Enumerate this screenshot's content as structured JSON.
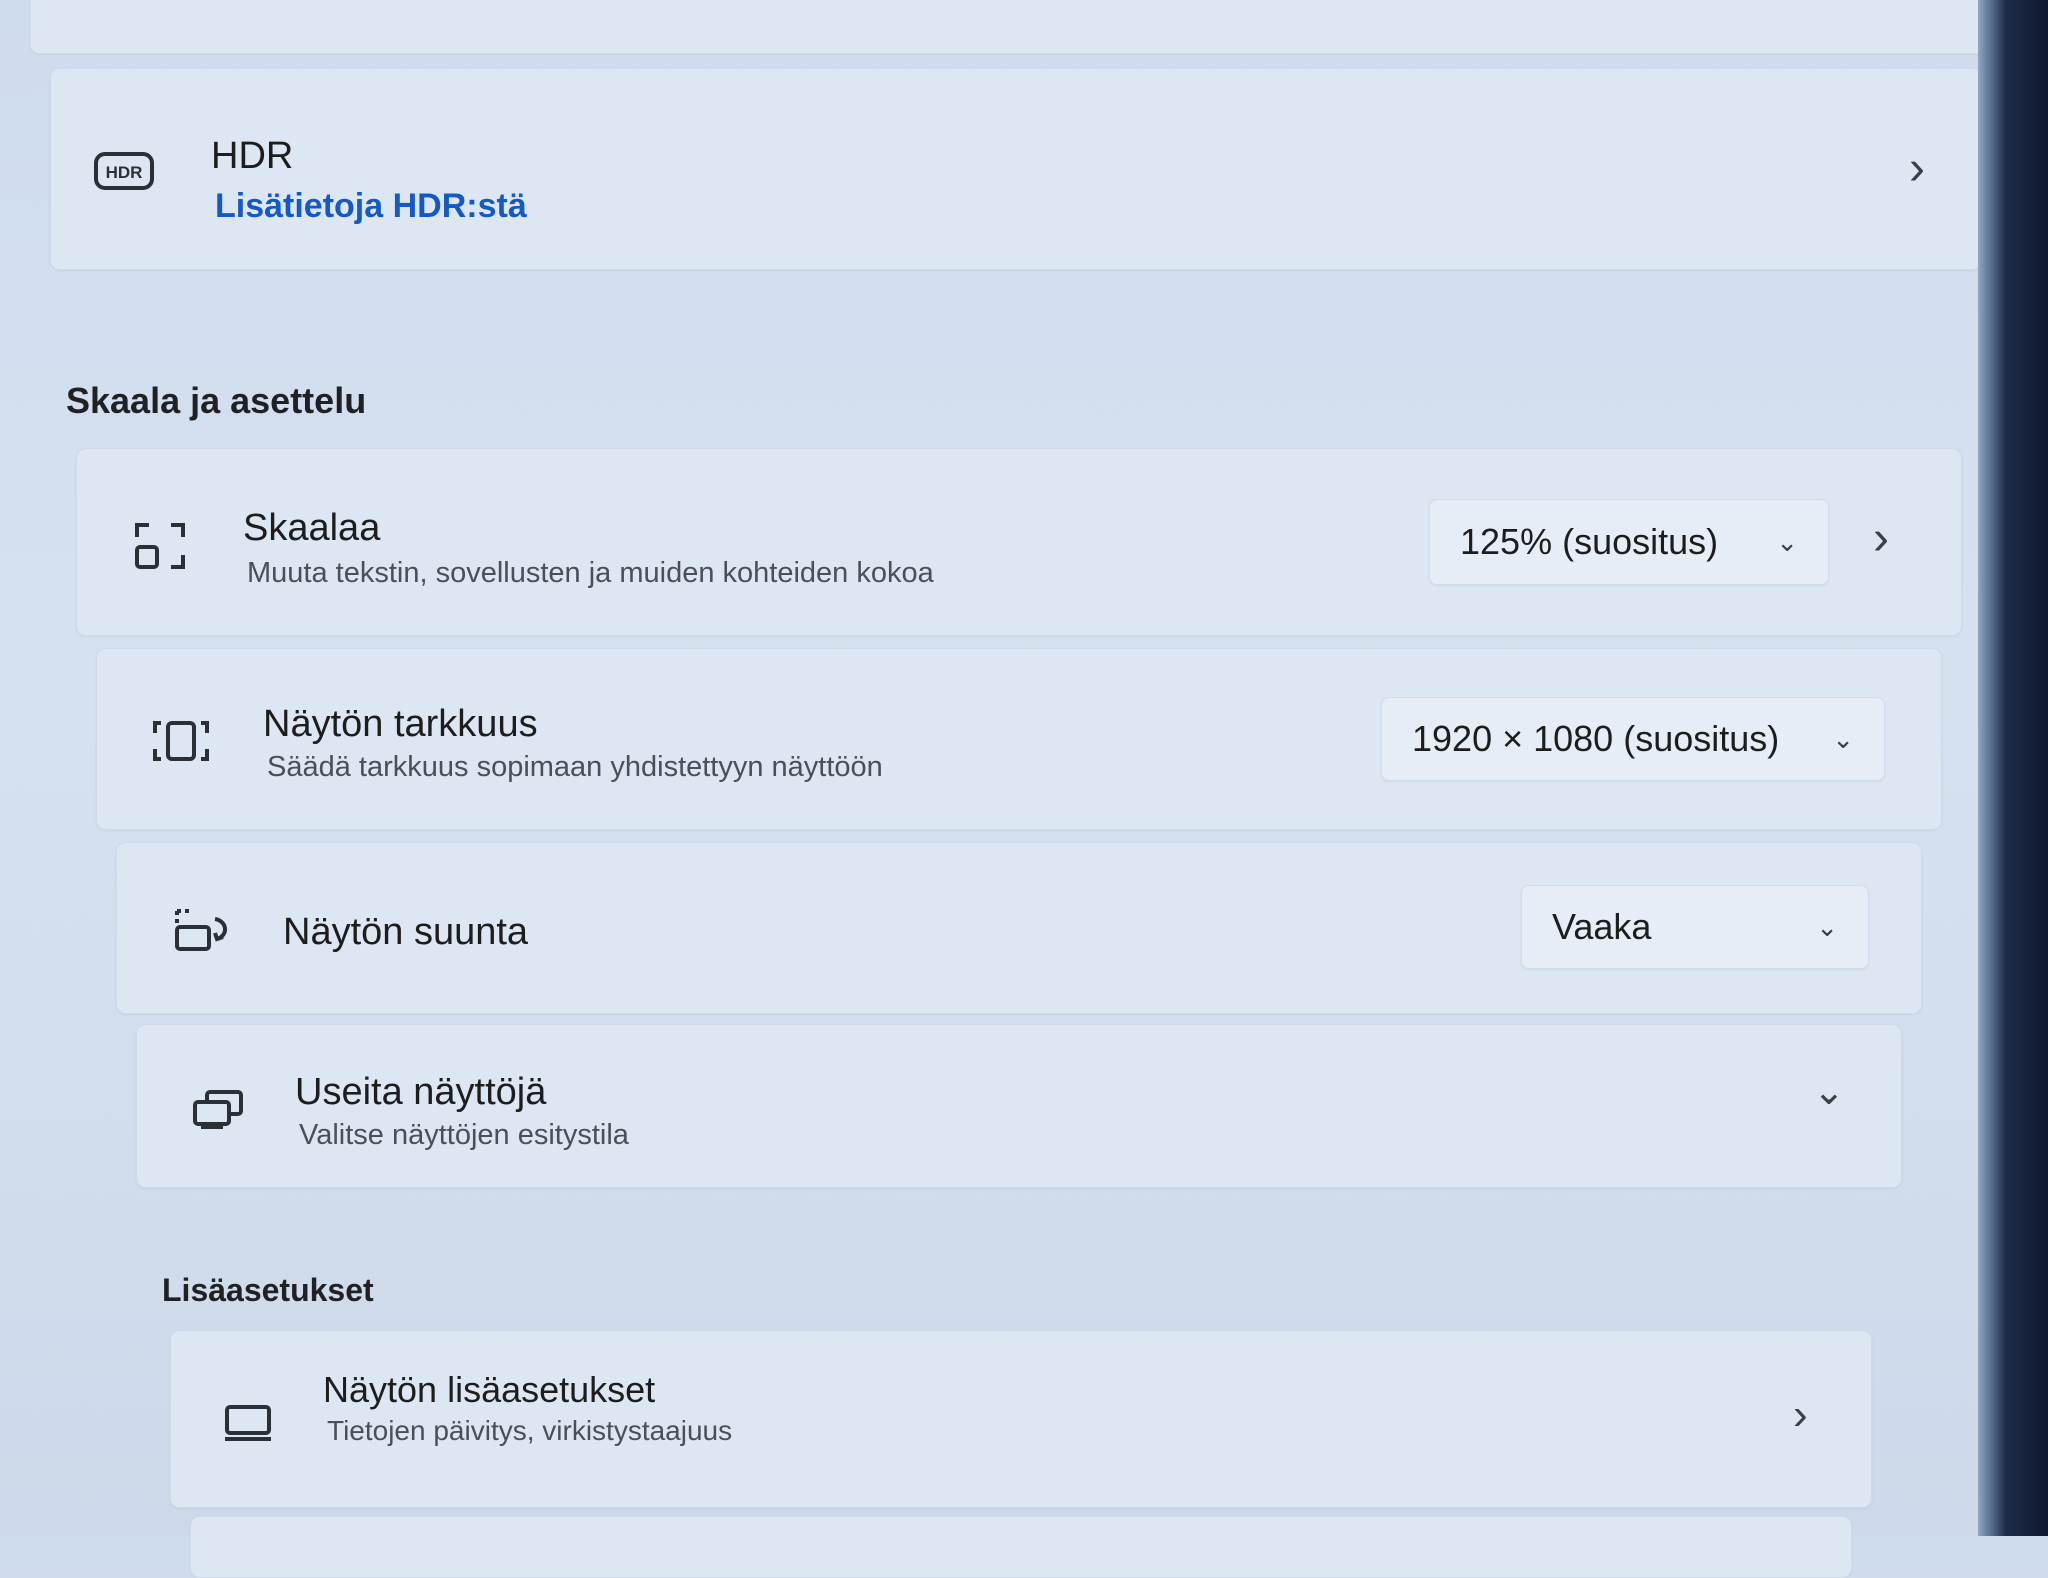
{
  "hdr": {
    "icon": "hdr-icon",
    "title": "HDR",
    "link": "Lisätietoja HDR:stä"
  },
  "scale_section": {
    "heading": "Skaala ja asettelu",
    "items": [
      {
        "icon": "scale-icon",
        "title": "Skaalaa",
        "subtitle": "Muuta tekstin, sovellusten ja muiden kohteiden kokoa",
        "dropdown_value": "125% (suositus)"
      },
      {
        "icon": "resolution-icon",
        "title": "Näytön tarkkuus",
        "subtitle": "Säädä tarkkuus sopimaan yhdistettyyn näyttöön",
        "dropdown_value": "1920 × 1080 (suositus)"
      },
      {
        "icon": "orientation-icon",
        "title": "Näytön suunta",
        "dropdown_value": "Vaaka"
      },
      {
        "icon": "multiple-displays-icon",
        "title": "Useita näyttöjä",
        "subtitle": "Valitse näyttöjen esitystila"
      }
    ]
  },
  "related": {
    "heading": "Lisäasetukset",
    "items": [
      {
        "icon": "monitor-icon",
        "title": "Näytön lisäasetukset",
        "subtitle": "Tietojen päivitys, virkistystaajuus"
      }
    ]
  },
  "colors": {
    "accent": "#1559c4",
    "card": "#dde7f4",
    "background": "#d3dfef"
  }
}
